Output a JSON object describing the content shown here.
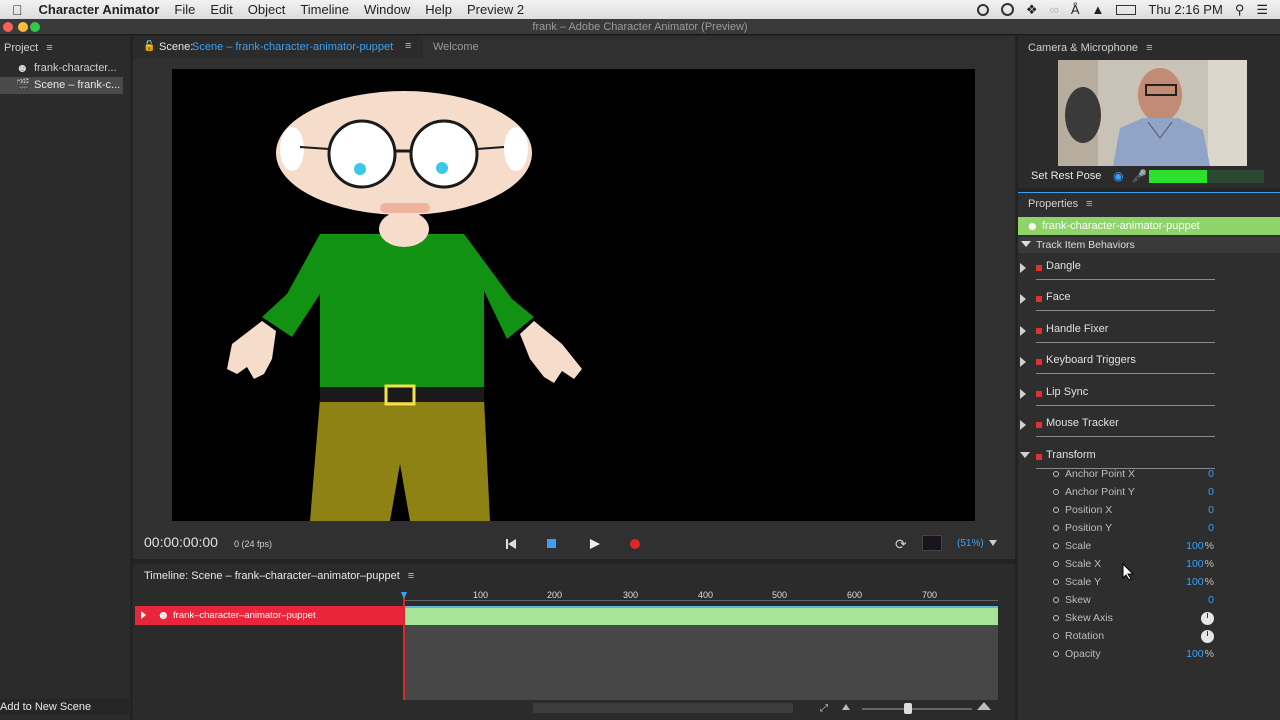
{
  "menubar": {
    "app": "Character Animator",
    "items": [
      "File",
      "Edit",
      "Object",
      "Timeline",
      "Window",
      "Help",
      "Preview 2"
    ],
    "clock": "Thu 2:16 PM"
  },
  "window": {
    "title": "frank – Adobe Character Animator (Preview)"
  },
  "project": {
    "tab": "Project",
    "items": [
      "frank-character...",
      "Scene – frank-c..."
    ],
    "add_button": "Add to New Scene"
  },
  "scene": {
    "tab_prefix": "Scene:",
    "tab_name": "Scene – frank-character-animator-puppet",
    "welcome_tab": "Welcome",
    "timecode": "00:00:00:00",
    "fps": "0 (24 fps)",
    "zoom": "(51%)"
  },
  "timeline": {
    "title": "Timeline: Scene – frank–character–animator–puppet",
    "ruler": [
      "100",
      "200",
      "300",
      "400",
      "500",
      "600",
      "700"
    ],
    "track_name": "frank–character–animator–puppet"
  },
  "camera": {
    "tab": "Camera & Microphone",
    "rest_pose": "Set Rest Pose",
    "mic_level": 0.5
  },
  "properties": {
    "tab": "Properties",
    "puppet": "frank-character-animator-puppet",
    "section": "Track Item Behaviors",
    "behaviors": [
      "Dangle",
      "Face",
      "Handle Fixer",
      "Keyboard Triggers",
      "Lip Sync",
      "Mouse Tracker",
      "Transform"
    ],
    "transform": [
      {
        "label": "Anchor Point X",
        "value": "0",
        "unit": ""
      },
      {
        "label": "Anchor Point Y",
        "value": "0",
        "unit": ""
      },
      {
        "label": "Position X",
        "value": "0",
        "unit": ""
      },
      {
        "label": "Position Y",
        "value": "0",
        "unit": ""
      },
      {
        "label": "Scale",
        "value": "100",
        "unit": "%"
      },
      {
        "label": "Scale X",
        "value": "100",
        "unit": "%"
      },
      {
        "label": "Scale Y",
        "value": "100",
        "unit": "%"
      },
      {
        "label": "Skew",
        "value": "0",
        "unit": ""
      },
      {
        "label": "Skew Axis",
        "value": "",
        "unit": ""
      },
      {
        "label": "Rotation",
        "value": "",
        "unit": ""
      },
      {
        "label": "Opacity",
        "value": "100",
        "unit": "%"
      }
    ]
  },
  "colors": {
    "accent_blue": "#3aa0f5",
    "track_red": "#e8253a",
    "track_green": "#a8e39a",
    "puppet_header": "#8fd36b",
    "record_red": "#e02525"
  }
}
